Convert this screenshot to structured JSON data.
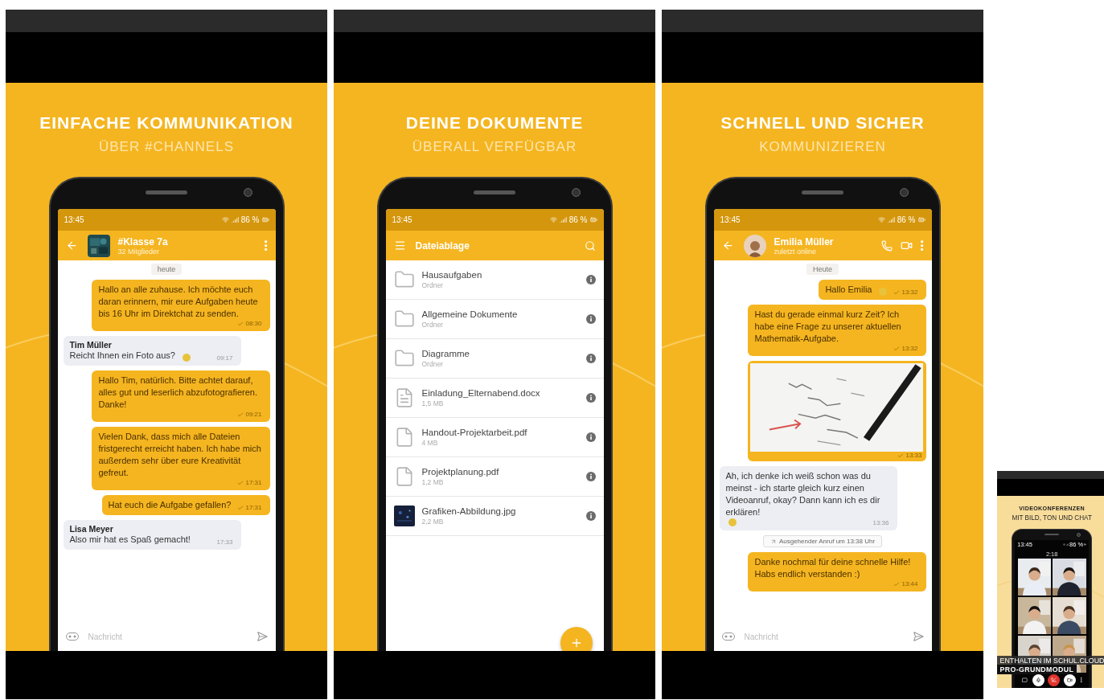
{
  "slides": [
    {
      "kind": "chat",
      "title": "EINFACHE KOMMUNIKATION",
      "subtitle": "ÜBER #CHANNELS",
      "status": {
        "time": "13:45",
        "battery": "86 %"
      },
      "header": {
        "nav": {
          "kind": "back"
        },
        "avatar": {
          "kind": "picture"
        },
        "title": "#Klasse 7a",
        "subtitle": "32 Mitglieder",
        "actions": [
          {
            "kind": "more"
          }
        ]
      },
      "date": "heute",
      "messages": [
        {
          "kind": "out",
          "text": "Hallo an alle zuhause. Ich möchte euch daran erinnern, mir eure Aufgaben heute bis 16 Uhr im Direktchat zu senden.",
          "time": "08:30"
        },
        {
          "kind": "in",
          "sender": "Tim Müller",
          "text": "Reicht Ihnen ein Foto aus?",
          "emoji": true,
          "time": "09:17"
        },
        {
          "kind": "out",
          "text": "Hallo Tim, natürlich. Bitte achtet darauf, alles gut und leserlich abzufotografieren. Danke!",
          "time": "09:21"
        },
        {
          "kind": "out",
          "text": "Vielen Dank, dass mich alle Dateien fristgerecht erreicht haben. Ich habe mich außerdem sehr über eure Kreativität gefreut.",
          "time": "17:31"
        },
        {
          "kind": "out",
          "text": "Hat euch die Aufgabe gefallen?",
          "time": "17:31"
        },
        {
          "kind": "in",
          "sender": "Lisa Meyer",
          "text": "Also mir hat es Spaß gemacht!",
          "time": "17:33"
        }
      ],
      "composer": {
        "placeholder": "Nachricht"
      }
    },
    {
      "kind": "files",
      "title": "DEINE DOKUMENTE",
      "subtitle": "ÜBERALL VERFÜGBAR",
      "status": {
        "time": "13:45",
        "battery": "86 %"
      },
      "header": {
        "nav": {
          "kind": "menu"
        },
        "title": "Dateiablage",
        "actions": [
          {
            "kind": "search"
          }
        ]
      },
      "files": [
        {
          "kind": "folder",
          "name": "Hausaufgaben",
          "meta": "Ordner"
        },
        {
          "kind": "folder",
          "name": "Allgemeine Dokumente",
          "meta": "Ordner"
        },
        {
          "kind": "folder",
          "name": "Diagramme",
          "meta": "Ordner"
        },
        {
          "kind": "doc",
          "name": "Einladung_Elternabend.docx",
          "meta": "1,5 MB"
        },
        {
          "kind": "pdf",
          "name": "Handout-Projektarbeit.pdf",
          "meta": "4 MB"
        },
        {
          "kind": "pdf",
          "name": "Projektplanung.pdf",
          "meta": "1,2 MB"
        },
        {
          "name": "Grafiken-Abbildung.jpg",
          "meta": "2,2 MB"
        }
      ]
    },
    {
      "kind": "chat",
      "title": "SCHNELL UND SICHER",
      "subtitle": "KOMMUNIZIEREN",
      "status": {
        "time": "13:45",
        "battery": "86 %"
      },
      "header": {
        "nav": {
          "kind": "back"
        },
        "avatar": {
          "kind": "person"
        },
        "title": "Emilia Müller",
        "subtitle": "zuletzt online",
        "actions": [
          {
            "kind": "call"
          },
          {
            "kind": "video"
          },
          {
            "kind": "more"
          }
        ]
      },
      "date": "Heute",
      "messages": [
        {
          "kind": "out",
          "text": "Hallo Emilia",
          "emoji": true,
          "time": "13:32"
        },
        {
          "kind": "out",
          "text": "Hast du gerade einmal kurz Zeit? Ich habe eine Frage zu unserer aktuellen Mathematik-Aufgabe.",
          "time": "13:32"
        },
        {
          "time": "13:33"
        },
        {
          "kind": "in",
          "text": "Ah, ich denke ich weiß schon was du meinst - ich starte gleich kurz einen Videoanruf, okay? Dann kann ich es dir erklären!",
          "emoji": true,
          "time": "13:36"
        },
        {
          "kind": "notice",
          "text": "Ausgehender Anruf um 13:38 Uhr"
        },
        {
          "kind": "out",
          "text": "Danke nochmal für deine schnelle Hilfe! Habs endlich verstanden :)",
          "time": "13:44"
        }
      ],
      "composer": {
        "placeholder": "Nachricht"
      }
    },
    {
      "kind": "video",
      "title": "VIDEOKONFERENZEN",
      "subtitle": "MIT BILD, TON UND CHAT",
      "status": {
        "time": "13:45",
        "battery": "86 %"
      },
      "duration": "2:18",
      "tiles": [
        {
          "kind": "picture"
        },
        {
          "kind": "picture"
        },
        {
          "kind": "picture"
        },
        {
          "kind": "picture"
        },
        {
          "kind": "picture"
        },
        {
          "kind": "picture"
        }
      ],
      "controls": [
        {
          "kind": "chat"
        },
        {
          "kind": "mic"
        },
        {
          "kind": "hangup"
        },
        {
          "kind": "camera"
        },
        {
          "kind": "more"
        }
      ],
      "banner": [
        "ENTHALTEN IM SCHUL.CLOUD",
        "PRO-GRUNDMODUL"
      ]
    }
  ]
}
